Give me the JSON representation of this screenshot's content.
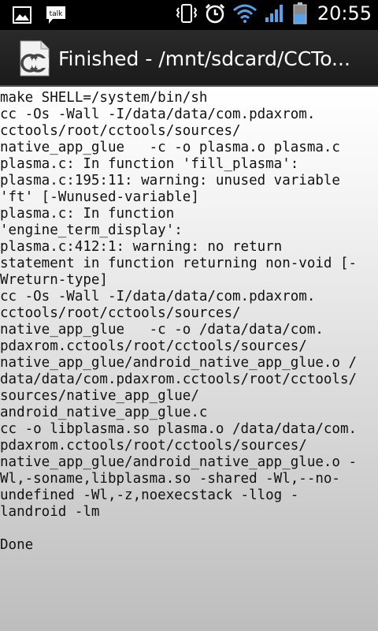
{
  "status_bar": {
    "clock": "20:55",
    "left_icons": [
      "picture-icon",
      "talk-icon"
    ],
    "right_icons": [
      "vibrate-icon",
      "alarm-icon",
      "wifi-icon",
      "signal-icon",
      "battery-icon"
    ],
    "talk_label": "talk"
  },
  "title_bar": {
    "title": "Finished - /mnt/sdcard/CCTo..."
  },
  "console": {
    "lines": [
      "make SHELL=/system/bin/sh",
      "cc -Os -Wall -I/data/data/com.pdaxrom.",
      "cctools/root/cctools/sources/",
      "native_app_glue   -c -o plasma.o plasma.c",
      "plasma.c: In function 'fill_plasma':",
      "plasma.c:195:11: warning: unused variable",
      "'ft' [-Wunused-variable]",
      "plasma.c: In function",
      "'engine_term_display':",
      "plasma.c:412:1: warning: no return",
      "statement in function returning non-void [-",
      "Wreturn-type]",
      "cc -Os -Wall -I/data/data/com.pdaxrom.",
      "cctools/root/cctools/sources/",
      "native_app_glue   -c -o /data/data/com.",
      "pdaxrom.cctools/root/cctools/sources/",
      "native_app_glue/android_native_app_glue.o /",
      "data/data/com.pdaxrom.cctools/root/cctools/",
      "sources/native_app_glue/",
      "android_native_app_glue.c",
      "cc -o libplasma.so plasma.o /data/data/com.",
      "pdaxrom.cctools/root/cctools/sources/",
      "native_app_glue/android_native_app_glue.o -",
      "Wl,-soname,libplasma.so -shared -Wl,--no-",
      "undefined -Wl,-z,noexecstack -llog -",
      "landroid -lm",
      "",
      "Done"
    ]
  }
}
